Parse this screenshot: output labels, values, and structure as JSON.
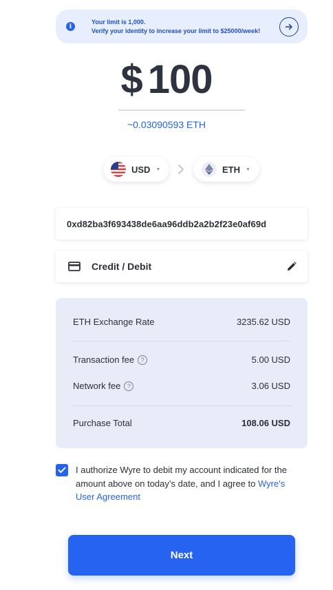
{
  "banner": {
    "line1": "Your limit is 1,000.",
    "line2": "Verify your identity to increase your limit to $25000/week!",
    "info_icon": "info-icon",
    "action_icon": "arrow-right-icon"
  },
  "amount": {
    "symbol": "$",
    "value": "100",
    "equivalent": "~0.03090593 ETH"
  },
  "pair": {
    "source": {
      "label": "USD",
      "icon": "us-flag-icon"
    },
    "destination": {
      "label": "ETH",
      "icon": "ethereum-icon"
    },
    "separator_icon": "chevron-right-icon"
  },
  "wallet": {
    "address": "0xd82ba3f693438de6aa96ddb2a2b2f23e0af69d"
  },
  "payment": {
    "method": "Credit / Debit",
    "icon": "credit-card-icon",
    "edit_icon": "pencil-icon"
  },
  "summary": {
    "rows": [
      {
        "label": "ETH Exchange Rate",
        "value": "3235.62 USD"
      },
      {
        "label": "Transaction fee",
        "value": "5.00 USD"
      },
      {
        "label": "Network fee",
        "value": "3.06 USD"
      },
      {
        "label": "Purchase Total",
        "value": "108.06 USD"
      }
    ],
    "help_glyph": "?"
  },
  "authorization": {
    "checked": true,
    "text": "I authorize Wyre to debit my account indicated for the amount above on today’s date, and I agree to ",
    "link_text": "Wyre's User Agreement"
  },
  "next_button": {
    "label": "Next"
  },
  "colors": {
    "accent": "#2563e8",
    "banner_bg": "#e7eefd",
    "summary_bg": "#e7ecf8",
    "text": "#2b2f36"
  }
}
